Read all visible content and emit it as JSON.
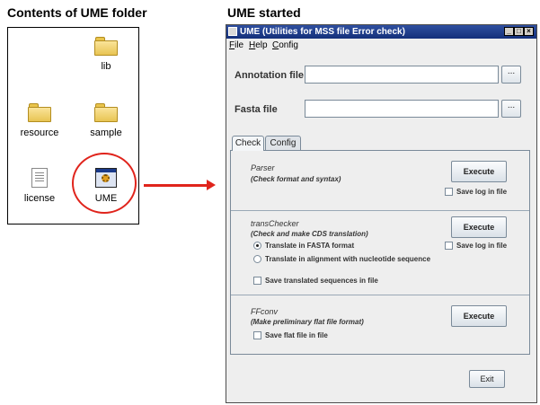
{
  "left": {
    "heading": "Contents of UME folder",
    "files": [
      {
        "label": "lib",
        "icon": "folder-icon"
      },
      {
        "label": "resource",
        "icon": "folder-icon"
      },
      {
        "label": "sample",
        "icon": "folder-icon"
      },
      {
        "label": "license",
        "icon": "document-icon"
      },
      {
        "label": "UME",
        "icon": "app-icon"
      }
    ],
    "highlight_color": "#e0241c"
  },
  "right": {
    "heading": "UME started",
    "window": {
      "title": "UME (Utilities for MSS file Error check)",
      "menu": [
        {
          "mnemonic": "F",
          "rest": "ile"
        },
        {
          "mnemonic": "H",
          "rest": "elp"
        },
        {
          "mnemonic": "C",
          "rest": "onfig"
        }
      ],
      "annotation_label": "Annotation file",
      "fasta_label": "Fasta  file",
      "browse_label": "...",
      "tabs": [
        "Check",
        "Config"
      ],
      "parser": {
        "title": "Parser",
        "desc": "(Check format and syntax)",
        "execute": "Execute",
        "save_log": "Save log in file"
      },
      "transchecker": {
        "title": "transChecker",
        "desc": "(Check and make CDS translation)",
        "execute": "Execute",
        "save_log": "Save log in file",
        "radio_fasta": "Translate in FASTA format",
        "radio_alignment": "Translate in alignment with nucleotide sequence",
        "save_translated": "Save translated sequences in file"
      },
      "ffconv": {
        "title": "FFconv",
        "desc": "(Make preliminary flat file format)",
        "execute": "Execute",
        "save_flat": "Save flat file in file"
      },
      "exit": "Exit"
    }
  }
}
